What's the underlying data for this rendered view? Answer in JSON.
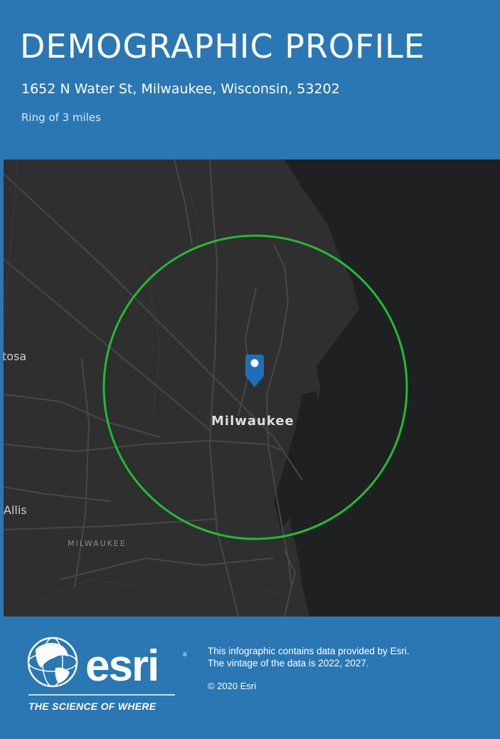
{
  "header": {
    "title": "DEMOGRAPHIC PROFILE",
    "address": "1652 N Water St, Milwaukee, Wisconsin, 53202",
    "ring": "Ring of 3 miles"
  },
  "map": {
    "labels": {
      "wauwatosa_partial": "tosa",
      "west_allis_partial": "Allis",
      "city": "Milwaukee",
      "county": "MILWAUKEE"
    },
    "colors": {
      "land": "#2f2f2f",
      "water": "#1e2022",
      "roads": "#4a4a4a",
      "ring": "#22bb33",
      "marker": "#1e6fb8"
    },
    "marker_icon": "location-pin-icon",
    "ring_radius_miles": 3
  },
  "footer": {
    "logo_text": "esri",
    "tagline": "THE SCIENCE OF WHERE",
    "registered_mark": "®",
    "credits_line1": "This infographic contains data provided by Esri.",
    "credits_line2": "The vintage of the data is 2022, 2027.",
    "copyright": "© 2020 Esri"
  }
}
